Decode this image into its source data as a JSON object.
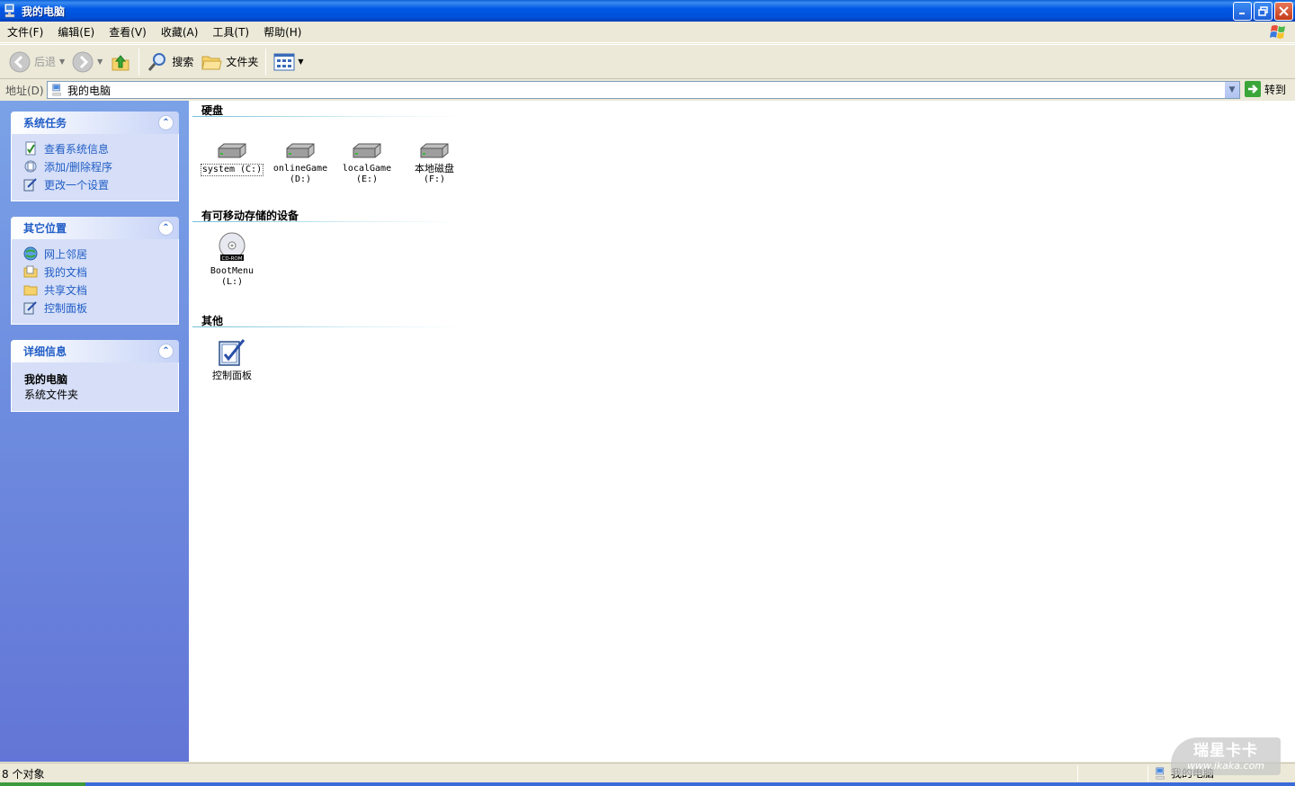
{
  "window": {
    "title": "我的电脑"
  },
  "menu": [
    "文件(F)",
    "编辑(E)",
    "查看(V)",
    "收藏(A)",
    "工具(T)",
    "帮助(H)"
  ],
  "toolbar": {
    "back_label": "后退",
    "search_label": "搜索",
    "folders_label": "文件夹"
  },
  "address": {
    "label": "地址(D)",
    "value": "我的电脑",
    "go_label": "转到"
  },
  "sidebar": {
    "system_tasks": {
      "title": "系统任务",
      "items": [
        "查看系统信息",
        "添加/删除程序",
        "更改一个设置"
      ]
    },
    "other_places": {
      "title": "其它位置",
      "items": [
        "网上邻居",
        "我的文档",
        "共享文档",
        "控制面板"
      ]
    },
    "details": {
      "title": "详细信息",
      "name": "我的电脑",
      "type": "系统文件夹"
    }
  },
  "groups": {
    "hard_disks": {
      "title": "硬盘",
      "items": [
        {
          "name": "system (C:)",
          "line1": "system (C:)",
          "line2": ""
        },
        {
          "name": "onlineGame (D:)",
          "line1": "onlineGame",
          "line2": "(D:)"
        },
        {
          "name": "localGame (E:)",
          "line1": "localGame",
          "line2": "(E:)"
        },
        {
          "name": "本地磁盘 (F:)",
          "line1": "本地磁盘",
          "line2": "(F:)"
        }
      ]
    },
    "removable": {
      "title": "有可移动存储的设备",
      "items": [
        {
          "line1": "BootMenu",
          "line2": "(L:)"
        }
      ]
    },
    "other": {
      "title": "其他",
      "items": [
        {
          "line1": "控制面板"
        }
      ]
    }
  },
  "status": {
    "count": "8 个对象",
    "location": "我的电脑"
  },
  "watermark": {
    "line1": "瑞星卡卡",
    "line2": "www.ikaka.com"
  },
  "colors": {
    "title_bar": "#0058E6",
    "task_pane": "#6F8FE0",
    "link": "#215DC6"
  }
}
